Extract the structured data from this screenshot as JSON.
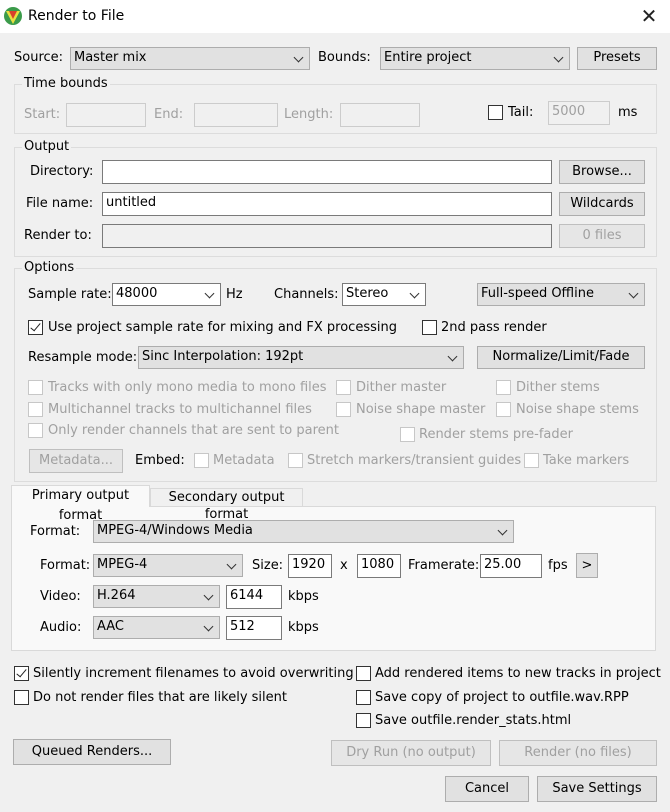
{
  "window": {
    "title": "Render to File",
    "close_glyph": "✕"
  },
  "source": {
    "label": "Source:",
    "value": "Master mix"
  },
  "bounds": {
    "label": "Bounds:",
    "value": "Entire project"
  },
  "presets_button": "Presets",
  "time_bounds": {
    "title": "Time bounds",
    "start_label": "Start:",
    "end_label": "End:",
    "length_label": "Length:",
    "tail_label": "Tail:",
    "tail_value": "5000",
    "tail_unit": "ms",
    "tail_checked": false
  },
  "output": {
    "title": "Output",
    "directory_label": "Directory:",
    "directory_value": "",
    "browse_button": "Browse...",
    "filename_label": "File name:",
    "filename_value": "untitled",
    "wildcards_button": "Wildcards",
    "render_to_label": "Render to:",
    "render_to_value": "",
    "files_button": "0 files"
  },
  "options": {
    "title": "Options",
    "sample_rate_label": "Sample rate:",
    "sample_rate_value": "48000",
    "hz_label": "Hz",
    "channels_label": "Channels:",
    "channels_value": "Stereo",
    "speed_value": "Full-speed Offline",
    "use_project_rate_label": "Use project sample rate for mixing and FX processing",
    "use_project_rate_checked": true,
    "second_pass_label": "2nd pass render",
    "second_pass_checked": false,
    "resample_label": "Resample mode:",
    "resample_value": "Sinc Interpolation: 192pt",
    "normalize_button": "Normalize/Limit/Fade",
    "mono_tracks_label": "Tracks with only mono media to mono files",
    "dither_master_label": "Dither master",
    "dither_stems_label": "Dither stems",
    "multichannel_label": "Multichannel tracks to multichannel files",
    "noise_master_label": "Noise shape master",
    "noise_stems_label": "Noise shape stems",
    "only_parent_label": "Only render channels that are sent to parent",
    "stems_prefader_label": "Render stems pre-fader",
    "metadata_button": "Metadata...",
    "embed_label": "Embed:",
    "embed_metadata_label": "Metadata",
    "embed_stretch_label": "Stretch markers/transient guides",
    "embed_take_label": "Take markers"
  },
  "tabs": [
    {
      "label": "Primary output format",
      "active": true
    },
    {
      "label": "Secondary output format",
      "active": false
    }
  ],
  "format_panel": {
    "format_label": "Format:",
    "format_value": "MPEG-4/Windows Media",
    "container_label": "Format:",
    "container_value": "MPEG-4",
    "size_label": "Size:",
    "width": "1920",
    "x_label": "x",
    "height": "1080",
    "framerate_label": "Framerate:",
    "framerate_value": "25.00",
    "fps_label": "fps",
    "more_button": ">",
    "video_label": "Video:",
    "video_codec": "H.264",
    "video_bitrate": "6144",
    "video_unit": "kbps",
    "audio_label": "Audio:",
    "audio_codec": "AAC",
    "audio_bitrate": "512",
    "audio_unit": "kbps"
  },
  "bottom": {
    "silently_increment_label": "Silently increment filenames to avoid overwriting",
    "silently_increment_checked": true,
    "add_to_tracks_label": "Add rendered items to new tracks in project",
    "add_to_tracks_checked": false,
    "not_silent_label": "Do not render files that are likely silent",
    "not_silent_checked": false,
    "save_copy_label": "Save copy of project to outfile.wav.RPP",
    "save_copy_checked": false,
    "save_stats_label": "Save outfile.render_stats.html",
    "save_stats_checked": false,
    "queued_button": "Queued Renders...",
    "dry_run_button": "Dry Run (no output)",
    "render_button": "Render (no files)",
    "cancel_button": "Cancel",
    "save_settings_button": "Save Settings"
  }
}
